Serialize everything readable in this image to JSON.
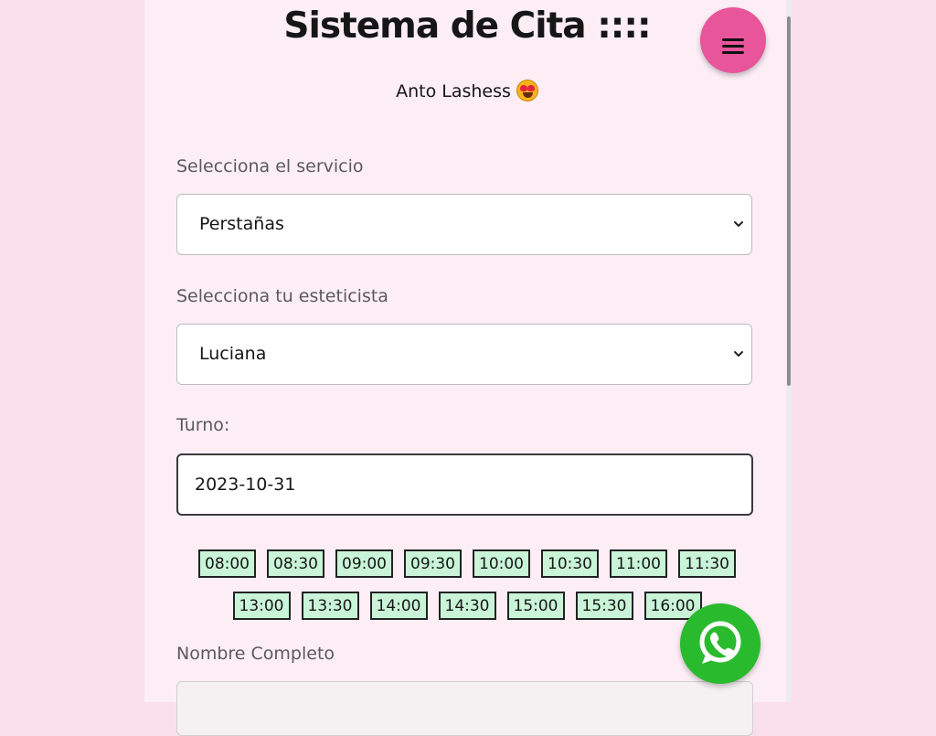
{
  "header": {
    "title": "Sistema de Cita ::::",
    "subtitle": "Anto Lashess",
    "menu_icon": "hamburger-menu-icon"
  },
  "form": {
    "service": {
      "label": "Selecciona el servicio",
      "value": "Perstañas"
    },
    "stylist": {
      "label": "Selecciona tu esteticista",
      "value": "Luciana"
    },
    "date": {
      "label": "Turno:",
      "value": "2023-10-31"
    },
    "time_slots": {
      "row1": [
        "08:00",
        "08:30",
        "09:00",
        "09:30",
        "10:00",
        "10:30",
        "11:00",
        "11:30"
      ],
      "row2": [
        "13:00",
        "13:30",
        "14:00",
        "14:30",
        "15:00",
        "15:30",
        "16:00"
      ]
    },
    "full_name": {
      "label": "Nombre Completo",
      "value": ""
    }
  },
  "colors": {
    "background": "#f9dfec",
    "panel": "#fdeef6",
    "menu_button": "#e8559a",
    "slot_fill": "#c9f4d8",
    "whatsapp": "#2aba2e"
  },
  "icons": {
    "whatsapp": "whatsapp-icon",
    "emoji": "heart-eyes-emoji-icon"
  }
}
